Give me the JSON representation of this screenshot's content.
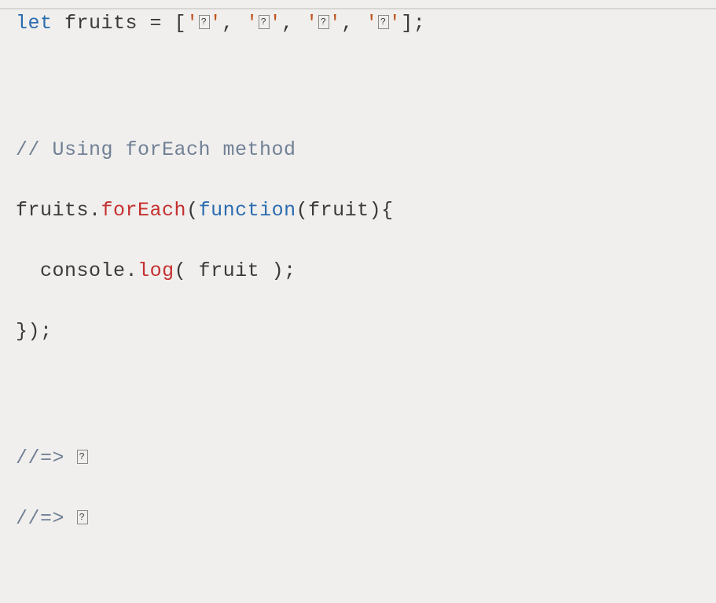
{
  "code": {
    "line1": {
      "let": "let ",
      "varname": "fruits ",
      "equals": "= ",
      "open": "[",
      "q": "'",
      "glyph": "?",
      "sep": ", ",
      "close": "];"
    },
    "comment1": "// Using forEach method",
    "line2": {
      "obj": "fruits",
      "dot": ".",
      "method": "forEach",
      "open": "(",
      "fn": "function",
      "paren_open": "(",
      "param": "fruit",
      "paren_close": ")",
      "brace": "{"
    },
    "line3": {
      "indent": "  ",
      "console": "console",
      "dot": ".",
      "log": "log",
      "open": "( ",
      "arg": "fruit",
      "close": " );"
    },
    "line4": "});",
    "out_prefix": "//=> ",
    "out_glyph": "?"
  }
}
